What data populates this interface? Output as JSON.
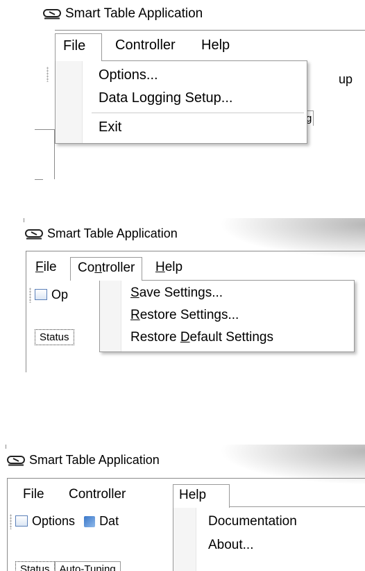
{
  "window_title": "Smart Table Application",
  "menu_labels": {
    "file": "File",
    "controller": "Controller",
    "help": "Help"
  },
  "panel1": {
    "items": [
      "Options...",
      "Data Logging Setup...",
      "Exit"
    ],
    "partial_toolbar_text": "up",
    "partial_tab_text": "g"
  },
  "panel2": {
    "menu": {
      "file": {
        "mnemonic": "F",
        "rest": "ile"
      },
      "controller": {
        "pre": "Co",
        "mnemonic": "n",
        "post": "troller"
      },
      "help": {
        "mnemonic": "H",
        "rest": "elp"
      }
    },
    "items": [
      {
        "pre": "",
        "mnemonic": "S",
        "post": "ave Settings..."
      },
      {
        "pre": "",
        "mnemonic": "R",
        "post": "estore Settings..."
      },
      {
        "pre": "Restore ",
        "mnemonic": "D",
        "post": "efault Settings"
      }
    ],
    "toolbar_partial": "Op",
    "tab_partial": "Status"
  },
  "panel3": {
    "items": [
      "Documentation",
      "About..."
    ],
    "toolbar": {
      "options": "Options",
      "data_partial": "Dat"
    },
    "tabs": [
      "Status",
      "Auto-Tuning"
    ]
  },
  "icons": {
    "app": "app-chain-icon",
    "options": "options-icon",
    "data": "data-logging-icon"
  }
}
